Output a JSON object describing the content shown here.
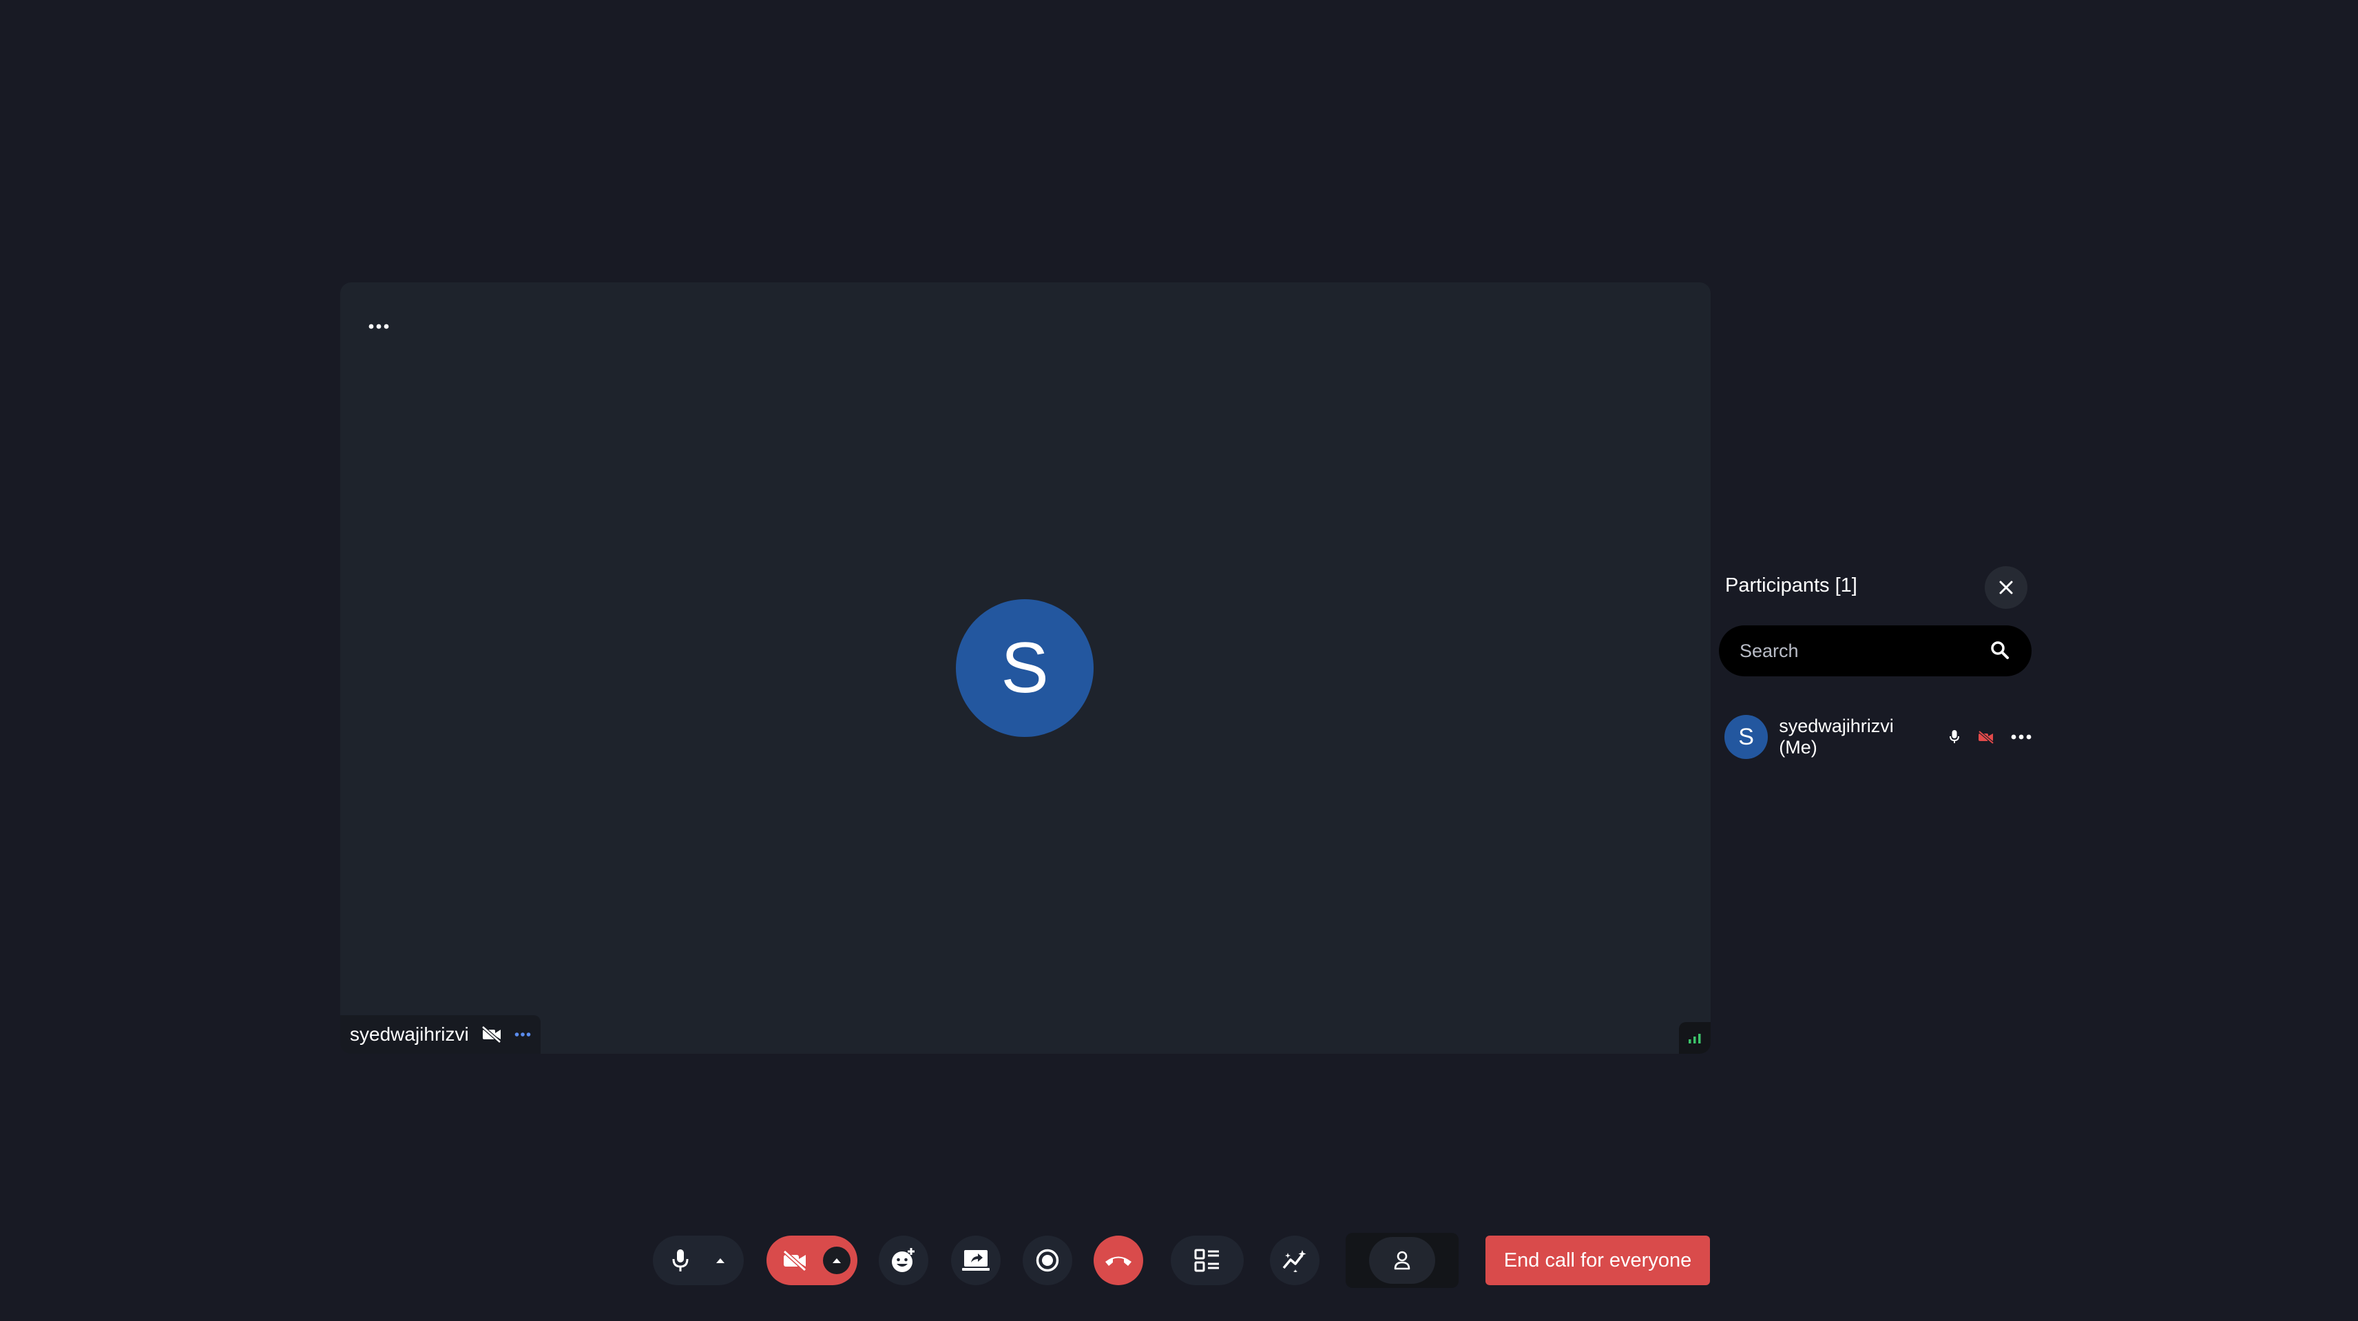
{
  "tile": {
    "avatar_initial": "S",
    "participant_name": "syedwajihrizvi",
    "icons": [
      "more-horizontal-icon",
      "video-off-icon",
      "more-horizontal-icon",
      "network-signal-icon"
    ]
  },
  "participants_panel": {
    "title": "Participants [1]",
    "search_placeholder": "Search",
    "participants": [
      {
        "initial": "S",
        "name": "syedwajihrizvi (Me)",
        "mic": "on",
        "camera": "off"
      }
    ]
  },
  "toolbar": {
    "buttons": [
      "microphone-icon",
      "chevron-up-icon",
      "video-off-icon",
      "chevron-up-icon",
      "emoji-add-icon",
      "screen-share-icon",
      "record-icon",
      "hang-up-icon",
      "layout-icon",
      "effects-icon",
      "person-icon"
    ],
    "end_call_label": "End call for everyone"
  },
  "colors": {
    "background": "#181a24",
    "tile": "#1e232c",
    "avatar": "#23579f",
    "danger": "#d94b4b",
    "signal": "#3cc46a"
  }
}
